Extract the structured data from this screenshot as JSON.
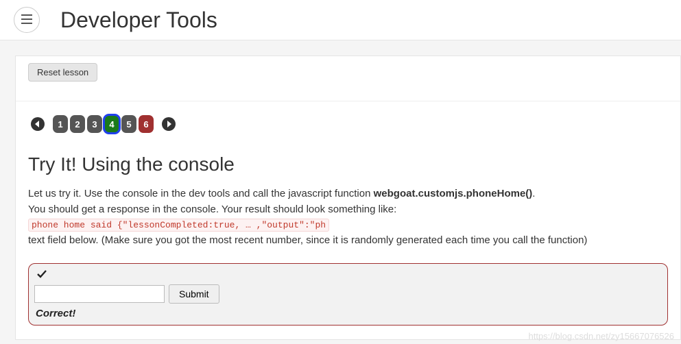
{
  "header": {
    "title": "Developer Tools"
  },
  "toolbar": {
    "reset_label": "Reset lesson"
  },
  "pager": {
    "steps": [
      "1",
      "2",
      "3",
      "4",
      "5",
      "6"
    ],
    "active_index": 3,
    "red_indices": [
      5
    ]
  },
  "lesson": {
    "heading": "Try It! Using the console",
    "intro_prefix": "Let us try it. Use the console in the dev tools and call the javascript function ",
    "intro_fn": "webgoat.customjs.phoneHome()",
    "intro_suffix": ".",
    "line2_prefix": "You should get a response in the console. Your result should look something like: ",
    "code_sample": "phone home said {\"lessonCompleted:true, … ,\"output\":\"ph",
    "line3": "text field below. (Make sure you got the most recent number, since it is randomly generated each time you call the function)"
  },
  "form": {
    "input_value": "",
    "submit_label": "Submit",
    "feedback": "Correct!"
  },
  "watermark": "https://blog.csdn.net/zy15667076526"
}
